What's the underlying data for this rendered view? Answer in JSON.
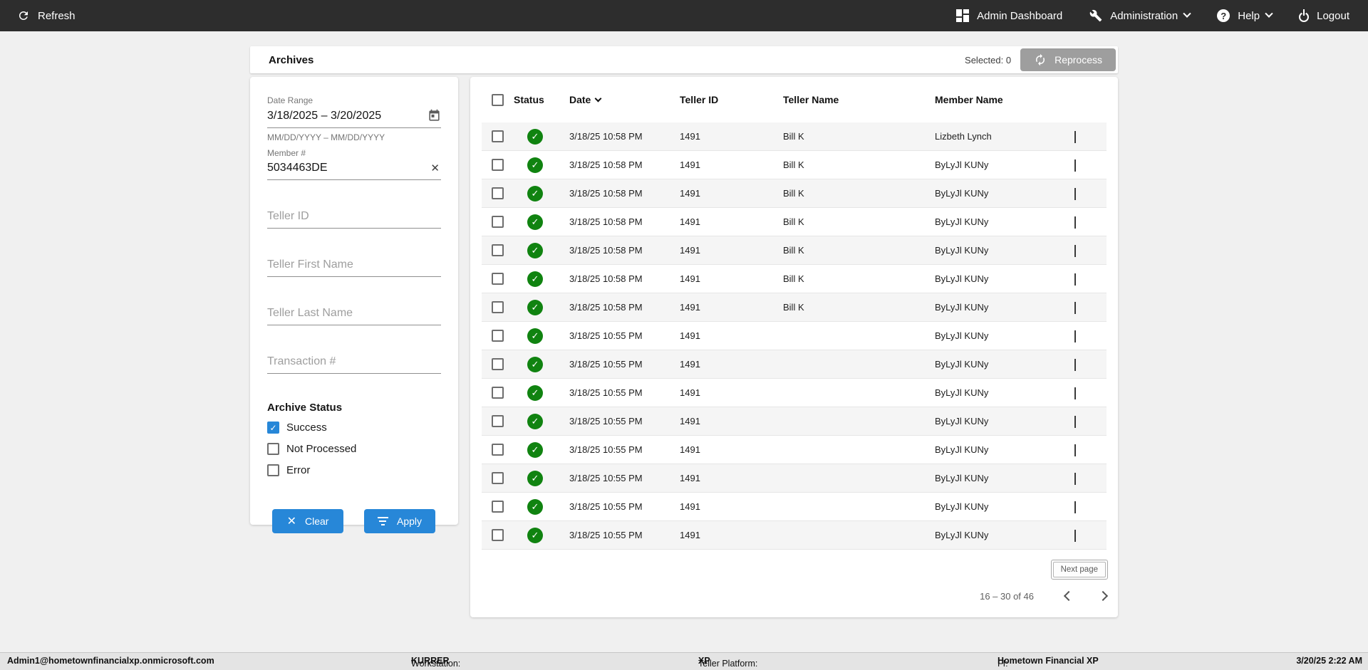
{
  "navbar": {
    "refresh_label": "Refresh",
    "items": [
      {
        "label": "Admin Dashboard",
        "icon": "dashboard-icon"
      },
      {
        "label": "Administration",
        "icon": "wrench-icon",
        "has_caret": true
      },
      {
        "label": "Help",
        "icon": "help-icon",
        "has_caret": true
      },
      {
        "label": "Logout",
        "icon": "power-icon"
      }
    ]
  },
  "header": {
    "title": "Archives",
    "selected_label": "Selected: 0",
    "reprocess_label": "Reprocess"
  },
  "filters": {
    "date_range": {
      "label": "Date Range",
      "value": "3/18/2025 – 3/20/2025",
      "helper": "MM/DD/YYYY – MM/DD/YYYY"
    },
    "member": {
      "label": "Member #",
      "value": "5034463DE"
    },
    "teller_id_placeholder": "Teller ID",
    "teller_first_placeholder": "Teller First Name",
    "teller_last_placeholder": "Teller Last Name",
    "transaction_placeholder": "Transaction #",
    "archive_status": {
      "label": "Archive Status",
      "options": [
        {
          "label": "Success",
          "checked": true
        },
        {
          "label": "Not Processed",
          "checked": false
        },
        {
          "label": "Error",
          "checked": false
        }
      ]
    },
    "clear_label": "Clear",
    "apply_label": "Apply"
  },
  "table": {
    "columns": {
      "status": "Status",
      "date": "Date",
      "teller_id": "Teller ID",
      "teller_name": "Teller Name",
      "member_name": "Member Name"
    },
    "sorted_column": "Date",
    "sort_direction": "desc",
    "rows": [
      {
        "status": "success",
        "date": "3/18/25 10:58 PM",
        "teller_id": "1491",
        "teller_name": "Bill K",
        "member_name": "Lizbeth Lynch"
      },
      {
        "status": "success",
        "date": "3/18/25 10:58 PM",
        "teller_id": "1491",
        "teller_name": "Bill K",
        "member_name": "ByLyJl KUNy"
      },
      {
        "status": "success",
        "date": "3/18/25 10:58 PM",
        "teller_id": "1491",
        "teller_name": "Bill K",
        "member_name": "ByLyJl KUNy"
      },
      {
        "status": "success",
        "date": "3/18/25 10:58 PM",
        "teller_id": "1491",
        "teller_name": "Bill K",
        "member_name": "ByLyJl KUNy"
      },
      {
        "status": "success",
        "date": "3/18/25 10:58 PM",
        "teller_id": "1491",
        "teller_name": "Bill K",
        "member_name": "ByLyJl KUNy"
      },
      {
        "status": "success",
        "date": "3/18/25 10:58 PM",
        "teller_id": "1491",
        "teller_name": "Bill K",
        "member_name": "ByLyJl KUNy"
      },
      {
        "status": "success",
        "date": "3/18/25 10:58 PM",
        "teller_id": "1491",
        "teller_name": "Bill K",
        "member_name": "ByLyJl KUNy"
      },
      {
        "status": "success",
        "date": "3/18/25 10:55 PM",
        "teller_id": "1491",
        "teller_name": "",
        "member_name": "ByLyJl KUNy"
      },
      {
        "status": "success",
        "date": "3/18/25 10:55 PM",
        "teller_id": "1491",
        "teller_name": "",
        "member_name": "ByLyJl KUNy"
      },
      {
        "status": "success",
        "date": "3/18/25 10:55 PM",
        "teller_id": "1491",
        "teller_name": "",
        "member_name": "ByLyJl KUNy"
      },
      {
        "status": "success",
        "date": "3/18/25 10:55 PM",
        "teller_id": "1491",
        "teller_name": "",
        "member_name": "ByLyJl KUNy"
      },
      {
        "status": "success",
        "date": "3/18/25 10:55 PM",
        "teller_id": "1491",
        "teller_name": "",
        "member_name": "ByLyJl KUNy"
      },
      {
        "status": "success",
        "date": "3/18/25 10:55 PM",
        "teller_id": "1491",
        "teller_name": "",
        "member_name": "ByLyJl KUNy"
      },
      {
        "status": "success",
        "date": "3/18/25 10:55 PM",
        "teller_id": "1491",
        "teller_name": "",
        "member_name": "ByLyJl KUNy"
      },
      {
        "status": "success",
        "date": "3/18/25 10:55 PM",
        "teller_id": "1491",
        "teller_name": "",
        "member_name": "ByLyJl KUNy"
      }
    ]
  },
  "pagination": {
    "range_label": "16 – 30 of 46",
    "next_page_tooltip": "Next page"
  },
  "statusbar": {
    "user": "Admin1@hometownfinancialxp.onmicrosoft.com",
    "workstation_label": "Workstation:",
    "workstation": "KURRER",
    "platform_label": "Teller Platform:",
    "platform": "XP",
    "fi_label": "FI:",
    "fi": "Hometown Financial XP",
    "datetime": "3/20/25 2:22 AM"
  },
  "colors": {
    "navbar": "#2d2d2d",
    "page": "#f0f0f0",
    "accent": "#2787d8",
    "green": "#108310",
    "disabled": "#9e9e9e",
    "stripe": "#f5f5f5",
    "statusbar": "#e4e4e4"
  }
}
